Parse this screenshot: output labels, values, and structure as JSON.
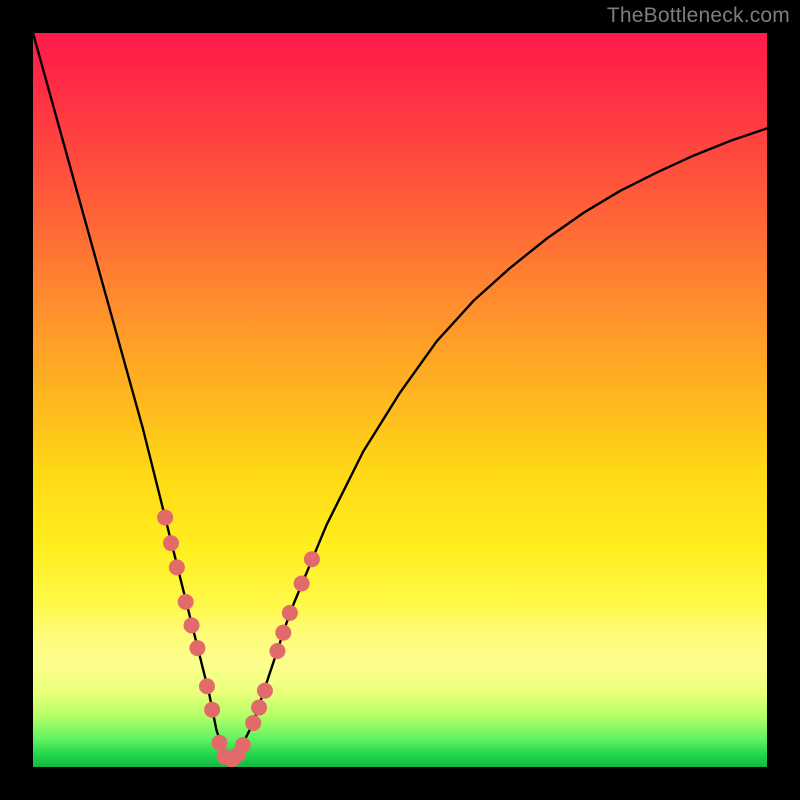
{
  "watermark": "TheBottleneck.com",
  "chart_data": {
    "type": "line",
    "title": "",
    "xlabel": "",
    "ylabel": "",
    "xlim": [
      0,
      100
    ],
    "ylim": [
      0,
      100
    ],
    "grid": false,
    "legend": false,
    "series": [
      {
        "name": "bottleneck-curve",
        "x": [
          0,
          5,
          10,
          15,
          18,
          20,
          22,
          24,
          25,
          26,
          27,
          28,
          30,
          32,
          35,
          40,
          45,
          50,
          55,
          60,
          65,
          70,
          75,
          80,
          85,
          90,
          95,
          100
        ],
        "values": [
          100,
          82,
          64,
          46,
          34,
          26,
          18,
          10,
          5,
          2,
          1,
          2,
          6,
          12,
          21,
          33,
          43,
          51,
          58,
          63.5,
          68,
          72,
          75.5,
          78.5,
          81,
          83.3,
          85.3,
          87
        ]
      }
    ],
    "markers": {
      "name": "highlight-points",
      "color": "#e26a6a",
      "points": [
        {
          "x": 18.0,
          "y": 34.0
        },
        {
          "x": 18.8,
          "y": 30.5
        },
        {
          "x": 19.6,
          "y": 27.2
        },
        {
          "x": 20.8,
          "y": 22.5
        },
        {
          "x": 21.6,
          "y": 19.3
        },
        {
          "x": 22.4,
          "y": 16.2
        },
        {
          "x": 23.7,
          "y": 11.0
        },
        {
          "x": 24.4,
          "y": 7.8
        },
        {
          "x": 25.4,
          "y": 3.3
        },
        {
          "x": 26.1,
          "y": 1.4
        },
        {
          "x": 27.1,
          "y": 1.0
        },
        {
          "x": 27.9,
          "y": 1.7
        },
        {
          "x": 28.6,
          "y": 3.0
        },
        {
          "x": 30.0,
          "y": 6.0
        },
        {
          "x": 30.8,
          "y": 8.1
        },
        {
          "x": 31.6,
          "y": 10.4
        },
        {
          "x": 33.3,
          "y": 15.8
        },
        {
          "x": 34.1,
          "y": 18.3
        },
        {
          "x": 35.0,
          "y": 21.0
        },
        {
          "x": 36.6,
          "y": 25.0
        },
        {
          "x": 38.0,
          "y": 28.3
        }
      ]
    },
    "background_gradient": {
      "top": "#ff1a4a",
      "mid": "#ffd916",
      "bottom": "#15b643"
    }
  }
}
